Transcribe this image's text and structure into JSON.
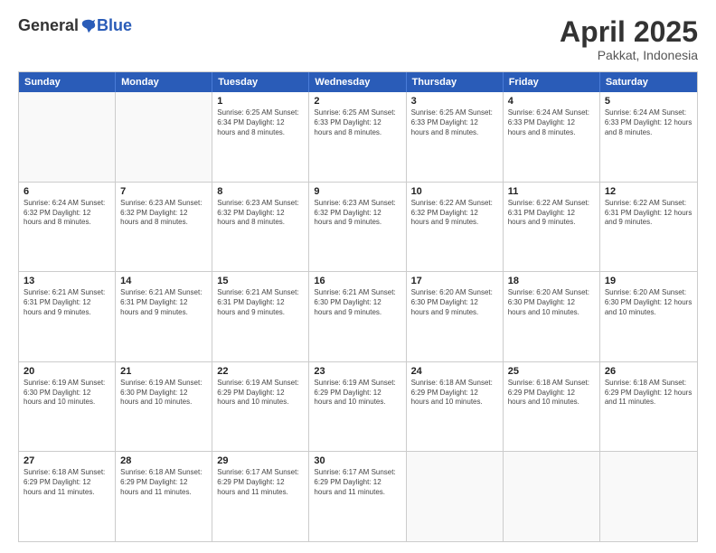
{
  "logo": {
    "general": "General",
    "blue": "Blue"
  },
  "title": "April 2025",
  "subtitle": "Pakkat, Indonesia",
  "header_days": [
    "Sunday",
    "Monday",
    "Tuesday",
    "Wednesday",
    "Thursday",
    "Friday",
    "Saturday"
  ],
  "weeks": [
    [
      {
        "day": "",
        "info": ""
      },
      {
        "day": "",
        "info": ""
      },
      {
        "day": "1",
        "info": "Sunrise: 6:25 AM\nSunset: 6:34 PM\nDaylight: 12 hours and 8 minutes."
      },
      {
        "day": "2",
        "info": "Sunrise: 6:25 AM\nSunset: 6:33 PM\nDaylight: 12 hours and 8 minutes."
      },
      {
        "day": "3",
        "info": "Sunrise: 6:25 AM\nSunset: 6:33 PM\nDaylight: 12 hours and 8 minutes."
      },
      {
        "day": "4",
        "info": "Sunrise: 6:24 AM\nSunset: 6:33 PM\nDaylight: 12 hours and 8 minutes."
      },
      {
        "day": "5",
        "info": "Sunrise: 6:24 AM\nSunset: 6:33 PM\nDaylight: 12 hours and 8 minutes."
      }
    ],
    [
      {
        "day": "6",
        "info": "Sunrise: 6:24 AM\nSunset: 6:32 PM\nDaylight: 12 hours and 8 minutes."
      },
      {
        "day": "7",
        "info": "Sunrise: 6:23 AM\nSunset: 6:32 PM\nDaylight: 12 hours and 8 minutes."
      },
      {
        "day": "8",
        "info": "Sunrise: 6:23 AM\nSunset: 6:32 PM\nDaylight: 12 hours and 8 minutes."
      },
      {
        "day": "9",
        "info": "Sunrise: 6:23 AM\nSunset: 6:32 PM\nDaylight: 12 hours and 9 minutes."
      },
      {
        "day": "10",
        "info": "Sunrise: 6:22 AM\nSunset: 6:32 PM\nDaylight: 12 hours and 9 minutes."
      },
      {
        "day": "11",
        "info": "Sunrise: 6:22 AM\nSunset: 6:31 PM\nDaylight: 12 hours and 9 minutes."
      },
      {
        "day": "12",
        "info": "Sunrise: 6:22 AM\nSunset: 6:31 PM\nDaylight: 12 hours and 9 minutes."
      }
    ],
    [
      {
        "day": "13",
        "info": "Sunrise: 6:21 AM\nSunset: 6:31 PM\nDaylight: 12 hours and 9 minutes."
      },
      {
        "day": "14",
        "info": "Sunrise: 6:21 AM\nSunset: 6:31 PM\nDaylight: 12 hours and 9 minutes."
      },
      {
        "day": "15",
        "info": "Sunrise: 6:21 AM\nSunset: 6:31 PM\nDaylight: 12 hours and 9 minutes."
      },
      {
        "day": "16",
        "info": "Sunrise: 6:21 AM\nSunset: 6:30 PM\nDaylight: 12 hours and 9 minutes."
      },
      {
        "day": "17",
        "info": "Sunrise: 6:20 AM\nSunset: 6:30 PM\nDaylight: 12 hours and 9 minutes."
      },
      {
        "day": "18",
        "info": "Sunrise: 6:20 AM\nSunset: 6:30 PM\nDaylight: 12 hours and 10 minutes."
      },
      {
        "day": "19",
        "info": "Sunrise: 6:20 AM\nSunset: 6:30 PM\nDaylight: 12 hours and 10 minutes."
      }
    ],
    [
      {
        "day": "20",
        "info": "Sunrise: 6:19 AM\nSunset: 6:30 PM\nDaylight: 12 hours and 10 minutes."
      },
      {
        "day": "21",
        "info": "Sunrise: 6:19 AM\nSunset: 6:30 PM\nDaylight: 12 hours and 10 minutes."
      },
      {
        "day": "22",
        "info": "Sunrise: 6:19 AM\nSunset: 6:29 PM\nDaylight: 12 hours and 10 minutes."
      },
      {
        "day": "23",
        "info": "Sunrise: 6:19 AM\nSunset: 6:29 PM\nDaylight: 12 hours and 10 minutes."
      },
      {
        "day": "24",
        "info": "Sunrise: 6:18 AM\nSunset: 6:29 PM\nDaylight: 12 hours and 10 minutes."
      },
      {
        "day": "25",
        "info": "Sunrise: 6:18 AM\nSunset: 6:29 PM\nDaylight: 12 hours and 10 minutes."
      },
      {
        "day": "26",
        "info": "Sunrise: 6:18 AM\nSunset: 6:29 PM\nDaylight: 12 hours and 11 minutes."
      }
    ],
    [
      {
        "day": "27",
        "info": "Sunrise: 6:18 AM\nSunset: 6:29 PM\nDaylight: 12 hours and 11 minutes."
      },
      {
        "day": "28",
        "info": "Sunrise: 6:18 AM\nSunset: 6:29 PM\nDaylight: 12 hours and 11 minutes."
      },
      {
        "day": "29",
        "info": "Sunrise: 6:17 AM\nSunset: 6:29 PM\nDaylight: 12 hours and 11 minutes."
      },
      {
        "day": "30",
        "info": "Sunrise: 6:17 AM\nSunset: 6:29 PM\nDaylight: 12 hours and 11 minutes."
      },
      {
        "day": "",
        "info": ""
      },
      {
        "day": "",
        "info": ""
      },
      {
        "day": "",
        "info": ""
      }
    ]
  ]
}
